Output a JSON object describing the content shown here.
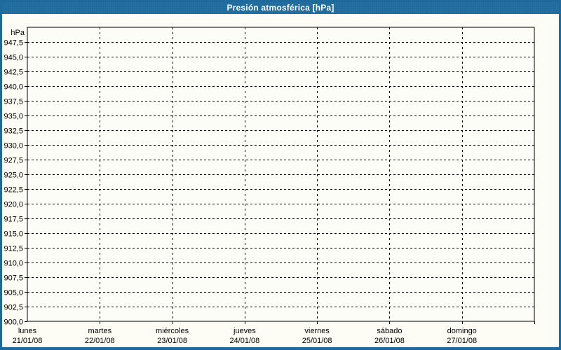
{
  "window": {
    "title": "Presión atmosférica [hPa]"
  },
  "colors": {
    "frame_blue": "#1e6a9d",
    "background": "#fdfdf6",
    "plot_background": "#fdfdf8",
    "grid": "#000000",
    "axis": "#000000",
    "text": "#000000",
    "title_text": "#ffffff"
  },
  "chart_data": {
    "type": "line",
    "title": "Presión atmosférica [hPa]",
    "y_unit_label": "hPa",
    "ylim": [
      900,
      950
    ],
    "ytick_step": 2.5,
    "yticks": [
      947.5,
      945.0,
      942.5,
      940.0,
      937.5,
      935.0,
      932.5,
      930.0,
      927.5,
      925.0,
      922.5,
      920.0,
      917.5,
      915.0,
      912.5,
      910.0,
      907.5,
      905.0,
      902.5,
      900.0
    ],
    "ytick_labels": [
      "947,5",
      "945,0",
      "942,5",
      "940,0",
      "937,5",
      "935,0",
      "932,5",
      "930,0",
      "927,5",
      "925,0",
      "922,5",
      "920,0",
      "917,5",
      "915,0",
      "912,5",
      "910,0",
      "907,5",
      "905,0",
      "902,5",
      "900,0"
    ],
    "categories": [
      {
        "day": "lunes",
        "date": "21/01/08"
      },
      {
        "day": "martes",
        "date": "22/01/08"
      },
      {
        "day": "miércoles",
        "date": "23/01/08"
      },
      {
        "day": "jueves",
        "date": "24/01/08"
      },
      {
        "day": "viernes",
        "date": "25/01/08"
      },
      {
        "day": "sábado",
        "date": "26/01/08"
      },
      {
        "day": "domingo",
        "date": "27/01/08"
      }
    ],
    "series": [],
    "grid": "dashed",
    "legend_position": "none"
  }
}
